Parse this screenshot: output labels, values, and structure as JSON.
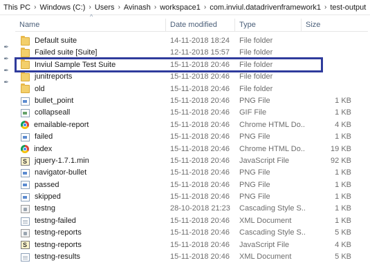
{
  "breadcrumb": [
    "This PC",
    "Windows (C:)",
    "Users",
    "Avinash",
    "workspace1",
    "com.inviul.datadrivenframework1",
    "test-output"
  ],
  "columns": {
    "name": "Name",
    "date": "Date modified",
    "type": "Type",
    "size": "Size"
  },
  "files": [
    {
      "name": "Default suite",
      "date": "14-11-2018 18:24",
      "type": "File folder",
      "size": "",
      "icon": "folder-icon"
    },
    {
      "name": "Failed suite [Suite]",
      "date": "12-11-2018 15:57",
      "type": "File folder",
      "size": "",
      "icon": "folder-icon"
    },
    {
      "name": "Inviul Sample Test Suite",
      "date": "15-11-2018 20:46",
      "type": "File folder",
      "size": "",
      "icon": "folder-icon"
    },
    {
      "name": "junitreports",
      "date": "15-11-2018 20:46",
      "type": "File folder",
      "size": "",
      "icon": "folder-icon"
    },
    {
      "name": "old",
      "date": "15-11-2018 20:46",
      "type": "File folder",
      "size": "",
      "icon": "folder-icon"
    },
    {
      "name": "bullet_point",
      "date": "15-11-2018 20:46",
      "type": "PNG File",
      "size": "1 KB",
      "icon": "png-file-icon"
    },
    {
      "name": "collapseall",
      "date": "15-11-2018 20:46",
      "type": "GIF File",
      "size": "1 KB",
      "icon": "gif-file-icon"
    },
    {
      "name": "emailable-report",
      "date": "15-11-2018 20:46",
      "type": "Chrome HTML Do...",
      "size": "4 KB",
      "icon": "chrome-html-icon"
    },
    {
      "name": "failed",
      "date": "15-11-2018 20:46",
      "type": "PNG File",
      "size": "1 KB",
      "icon": "png-file-icon"
    },
    {
      "name": "index",
      "date": "15-11-2018 20:46",
      "type": "Chrome HTML Do...",
      "size": "19 KB",
      "icon": "chrome-html-icon"
    },
    {
      "name": "jquery-1.7.1.min",
      "date": "15-11-2018 20:46",
      "type": "JavaScript File",
      "size": "92 KB",
      "icon": "javascript-file-icon"
    },
    {
      "name": "navigator-bullet",
      "date": "15-11-2018 20:46",
      "type": "PNG File",
      "size": "1 KB",
      "icon": "png-file-icon"
    },
    {
      "name": "passed",
      "date": "15-11-2018 20:46",
      "type": "PNG File",
      "size": "1 KB",
      "icon": "png-file-icon"
    },
    {
      "name": "skipped",
      "date": "15-11-2018 20:46",
      "type": "PNG File",
      "size": "1 KB",
      "icon": "png-file-icon"
    },
    {
      "name": "testng",
      "date": "28-10-2018 21:23",
      "type": "Cascading Style S...",
      "size": "1 KB",
      "icon": "css-file-icon"
    },
    {
      "name": "testng-failed",
      "date": "15-11-2018 20:46",
      "type": "XML Document",
      "size": "1 KB",
      "icon": "xml-file-icon"
    },
    {
      "name": "testng-reports",
      "date": "15-11-2018 20:46",
      "type": "Cascading Style S...",
      "size": "5 KB",
      "icon": "css-file-icon"
    },
    {
      "name": "testng-reports",
      "date": "15-11-2018 20:46",
      "type": "JavaScript File",
      "size": "4 KB",
      "icon": "javascript-file-icon"
    },
    {
      "name": "testng-results",
      "date": "15-11-2018 20:46",
      "type": "XML Document",
      "size": "5 KB",
      "icon": "xml-file-icon"
    }
  ],
  "highlight_color": "#2f3b9c"
}
